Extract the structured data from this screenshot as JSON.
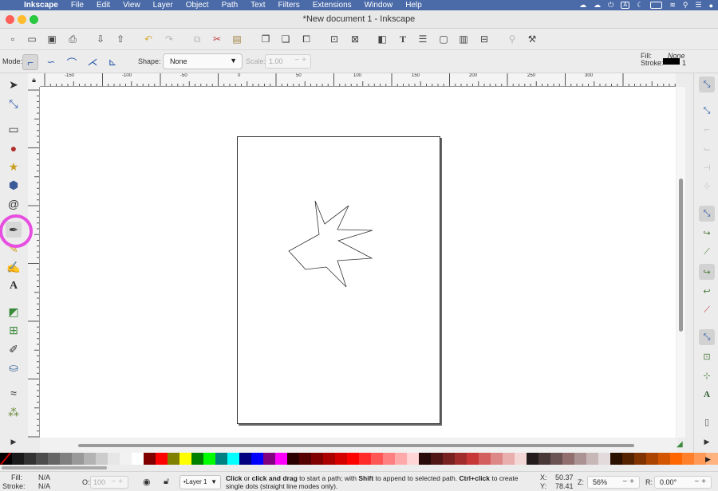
{
  "menubar": {
    "app": "Inkscape",
    "items": [
      "File",
      "Edit",
      "View",
      "Layer",
      "Object",
      "Path",
      "Text",
      "Filters",
      "Extensions",
      "Window",
      "Help"
    ],
    "status_icons": [
      "creative-cloud-icon",
      "icloud-icon",
      "power-icon",
      "input-source-icon",
      "moon-icon",
      "battery-icon",
      "wifi-icon",
      "spotlight-icon",
      "control-center-icon",
      "siri-icon"
    ],
    "input_source": "A"
  },
  "window": {
    "title": "*New document 1 - Inkscape"
  },
  "controls": {
    "mode_label": "Mode:",
    "shape_label": "Shape:",
    "shape_value": "None",
    "scale_label": "Scale:",
    "scale_value": "1.00",
    "fill_label": "Fill:",
    "fill_value": "None",
    "stroke_label": "Stroke:",
    "stroke_width": "1"
  },
  "ruler": {
    "h_labels": [
      "-150",
      "-100",
      "-50",
      "0",
      "50",
      "100",
      "150",
      "200",
      "250",
      "300"
    ]
  },
  "palette": {
    "colors": [
      "#000000",
      "#1a1a1a",
      "#333333",
      "#4d4d4d",
      "#666666",
      "#808080",
      "#999999",
      "#b3b3b3",
      "#cccccc",
      "#e6e6e6",
      "#f2f2f2",
      "#ffffff",
      "#800000",
      "#ff0000",
      "#808000",
      "#ffff00",
      "#008000",
      "#00ff00",
      "#008080",
      "#00ffff",
      "#000080",
      "#0000ff",
      "#800080",
      "#ff00ff",
      "#2b0000",
      "#550000",
      "#800000",
      "#aa0000",
      "#d40000",
      "#ff0000",
      "#ff2a2a",
      "#ff5555",
      "#ff8080",
      "#ffaaaa",
      "#ffd5d5",
      "#280b0b",
      "#501616",
      "#782121",
      "#a02c2c",
      "#c83737",
      "#d35f5f",
      "#de8787",
      "#e9afaf",
      "#f4d7d7",
      "#241c1c",
      "#483737",
      "#6c5353",
      "#916f6f",
      "#ac9393",
      "#c8b7b7",
      "#e3dbdb",
      "#2b1100",
      "#552200",
      "#803300",
      "#aa4400",
      "#d45500",
      "#ff6600",
      "#ff7f2a",
      "#ff9955",
      "#ffb380",
      "#ffccaa",
      "#ffe6d5",
      "#28170b"
    ]
  },
  "status": {
    "fill_label": "Fill:",
    "fill_value": "N/A",
    "stroke_label": "Stroke:",
    "stroke_value": "N/A",
    "opacity_label": "O:",
    "opacity_value": "100",
    "layer": "•Layer 1",
    "message_bold1": "Click",
    "message_t1": " or ",
    "message_bold2": "click and drag",
    "message_t2": " to start a path; with ",
    "message_bold3": "Shift",
    "message_t3": " to append to selected path. ",
    "message_bold4": "Ctrl+click",
    "message_t4": " to create single dots (straight line modes only).",
    "x_label": "X:",
    "x_value": "50.37",
    "y_label": "Y:",
    "y_value": "78.41",
    "zoom_label": "Z:",
    "zoom_value": "56%",
    "rot_label": "R:",
    "rot_value": "0.00°"
  }
}
